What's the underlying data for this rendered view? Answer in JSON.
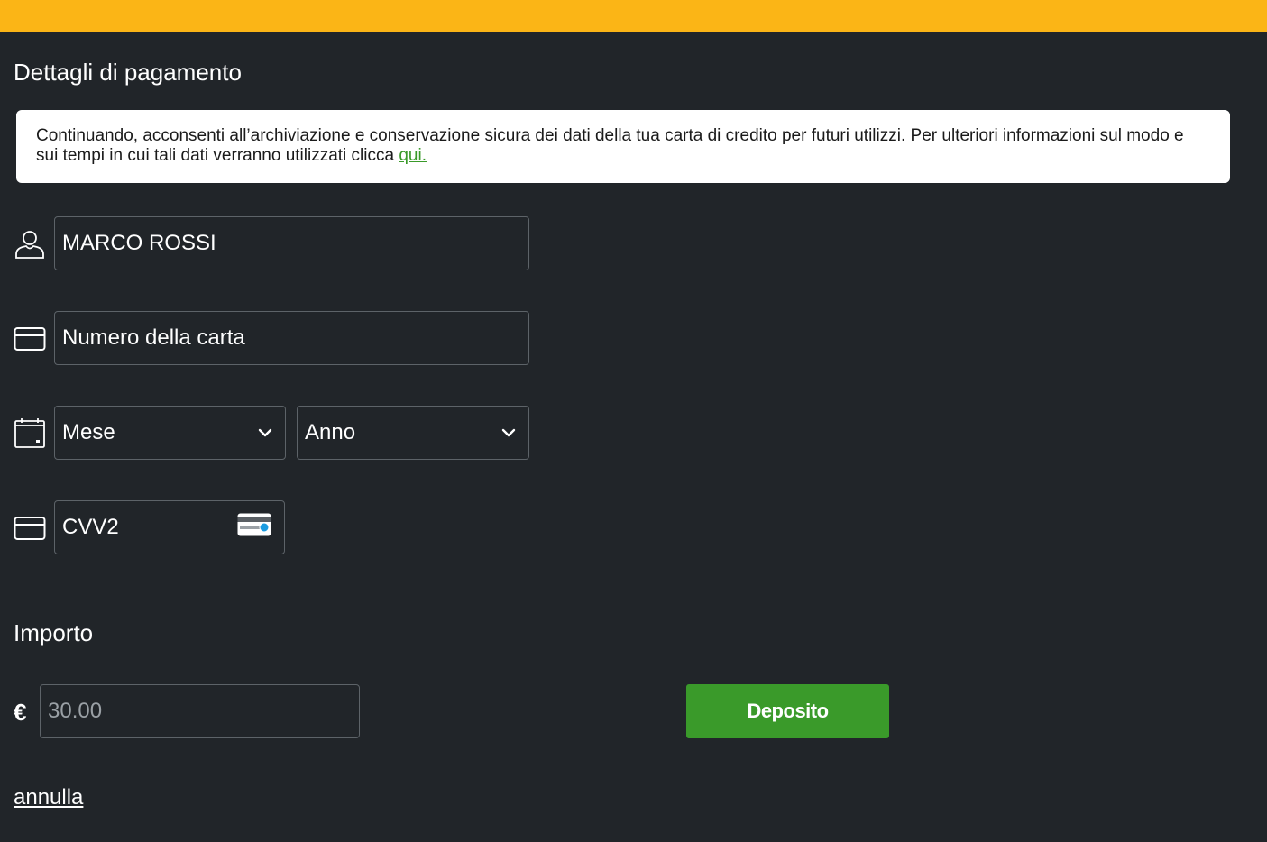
{
  "header": {
    "accent_color": "#fbb516"
  },
  "payment": {
    "title": "Dettagli di pagamento",
    "consent_text": "Continuando, acconsenti all’archiviazione e conservazione sicura dei dati della tua carta di credito per futuri utilizzi. Per ulteriori informazioni sul modo e sui tempi in cui tali dati verranno utilizzati clicca ",
    "consent_link": "qui."
  },
  "form": {
    "cardholder_name": "MARCO ROSSI",
    "card_number_placeholder": "Numero della carta",
    "month_selected": "Mese",
    "year_selected": "Anno",
    "cvv_placeholder": "CVV2",
    "icons": {
      "name": "user-icon",
      "card": "credit-card-icon",
      "expiry": "calendar-icon",
      "cvv": "credit-card-icon",
      "cvv_hint": "cvv-card-icon",
      "dropdown": "chevron-down-icon"
    }
  },
  "amount": {
    "title": "Importo",
    "currency": "€",
    "value": "30.00"
  },
  "actions": {
    "deposit_label": "Deposito",
    "deposit_color": "#3a9a2a",
    "cancel_label": "annulla"
  },
  "colors": {
    "background": "#212529",
    "link": "#3a9a2a"
  }
}
